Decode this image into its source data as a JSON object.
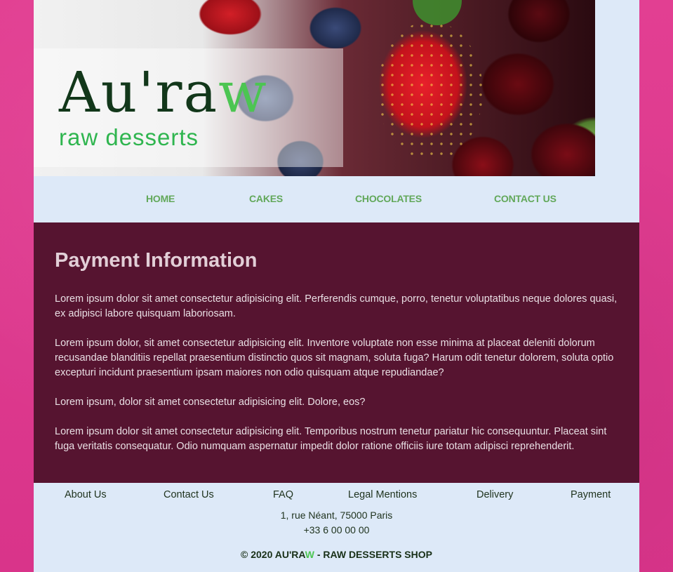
{
  "brand": {
    "logo_main": "Au'ra",
    "logo_accent": "w",
    "tagline": "raw desserts",
    "accent_color": "#4cc552"
  },
  "nav": {
    "items": [
      "HOME",
      "CAKES",
      "CHOCOLATES",
      "CONTACT US"
    ]
  },
  "content": {
    "heading": "Payment Information",
    "paragraphs": [
      "Lorem ipsum dolor sit amet consectetur adipisicing elit. Perferendis cumque, porro, tenetur voluptatibus neque dolores quasi, ex adipisci labore quisquam laboriosam.",
      "Lorem ipsum dolor, sit amet consectetur adipisicing elit. Inventore voluptate non esse minima at placeat deleniti dolorum recusandae blanditiis repellat praesentium distinctio quos sit magnam, soluta fuga? Harum odit tenetur dolorem, soluta optio excepturi incidunt praesentium ipsam maiores non odio quisquam atque repudiandae?",
      "Lorem ipsum, dolor sit amet consectetur adipisicing elit. Dolore, eos?",
      "Lorem ipsum dolor sit amet consectetur adipisicing elit. Temporibus nostrum tenetur pariatur hic consequuntur. Placeat sint fuga veritatis consequatur. Odio numquam aspernatur impedit dolor ratione officiis iure totam adipisci reprehenderit."
    ],
    "background_color": "#561430"
  },
  "footer": {
    "links": [
      "About Us",
      "Contact Us",
      "FAQ",
      "Legal Mentions",
      "Delivery",
      "Payment"
    ],
    "address": "1, rue Néant, 75000 Paris",
    "phone": "+33 6 00 00 00",
    "copyright_prefix": "© 2020 AU'RA",
    "copyright_accent": "W",
    "copyright_suffix": " - RAW DESSERTS SHOP"
  }
}
